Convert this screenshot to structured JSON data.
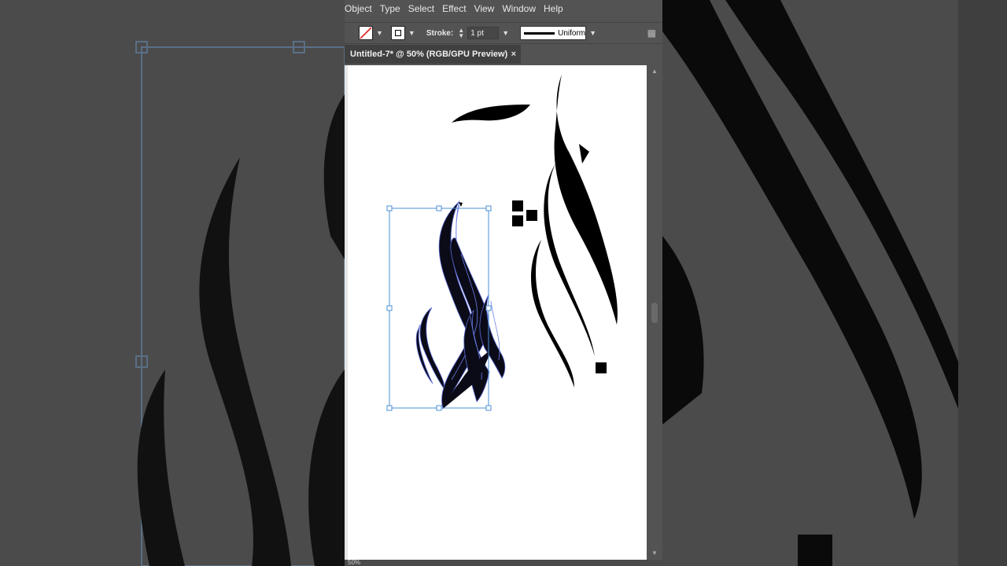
{
  "menu": {
    "items": [
      "Object",
      "Type",
      "Select",
      "Effect",
      "View",
      "Window",
      "Help"
    ]
  },
  "control": {
    "stroke_label": "Stroke:",
    "stroke_weight": "1 pt",
    "profile_label": "Uniform"
  },
  "document": {
    "tab_title": "Untitled-7* @ 50% (RGB/GPU Preview)",
    "close_symbol": "×"
  },
  "status": {
    "zoom": "50%"
  },
  "colors": {
    "ui_panel": "#535353",
    "artboard": "#ffffff",
    "selection": "#4a8fd6",
    "artwork": "#000000"
  }
}
